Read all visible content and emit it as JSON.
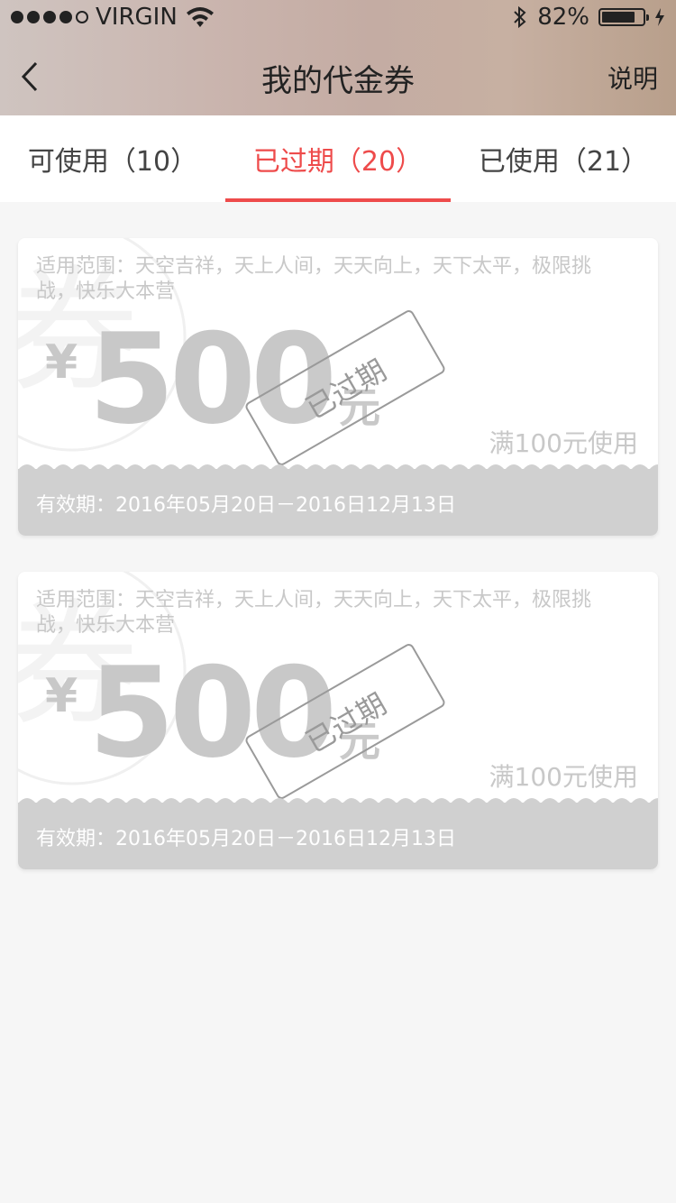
{
  "status_bar": {
    "carrier": "VIRGIN",
    "battery_percent": "82%",
    "battery_level": 0.82,
    "signal_dots": 5,
    "signal_filled": 4,
    "icons": [
      "wifi-icon",
      "bluetooth-icon",
      "battery-icon",
      "charging-icon"
    ]
  },
  "nav": {
    "title": "我的代金券",
    "right_label": "说明",
    "back_icon": "chevron-left-icon"
  },
  "tabs": [
    {
      "label": "可使用（10）",
      "active": false
    },
    {
      "label": "已过期（20）",
      "active": true
    },
    {
      "label": "已使用（21）",
      "active": false
    }
  ],
  "colors": {
    "accent": "#ee4b4b",
    "expired_gray": "#c8c8c8",
    "footer_gray": "#d0d0d0"
  },
  "coupons": [
    {
      "scope": "适用范围：天空吉祥，天上人间，天天向上，天下太平，极限挑战，快乐大本营",
      "currency": "¥",
      "amount": "500",
      "unit": "元",
      "condition": "满100元使用",
      "stamp": "已过期",
      "validity": "有效期：2016年05月20日－2016日12月13日",
      "watermark": "券"
    },
    {
      "scope": "适用范围：天空吉祥，天上人间，天天向上，天下太平，极限挑战，快乐大本营",
      "currency": "¥",
      "amount": "500",
      "unit": "元",
      "condition": "满100元使用",
      "stamp": "已过期",
      "validity": "有效期：2016年05月20日－2016日12月13日",
      "watermark": "券"
    }
  ]
}
